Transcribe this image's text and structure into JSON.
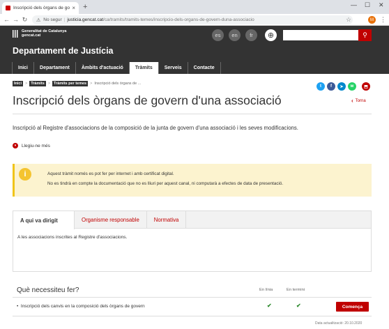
{
  "browser": {
    "tab_title": "Inscripció dels òrgans de govern",
    "tab_close": "×",
    "new_tab": "+",
    "minimize": "—",
    "maximize": "☐",
    "close": "✕",
    "security": "No segur",
    "url_domain": "justicia.gencat.cat",
    "url_path": "/ca/tramits/tramits-temes/inscripcio-dels-organs-de-govern-duna-associacio",
    "profile_initial": "M"
  },
  "header": {
    "logo_line1": "Generalitat de Catalunya",
    "logo_line2": "gencat.cat",
    "languages": [
      "es",
      "en",
      "fr"
    ],
    "search_placeholder": "",
    "department": "Departament de Justícia",
    "nav": [
      "Inici",
      "Departament",
      "Àmbits d'actuació",
      "Tràmits",
      "Serveis",
      "Contacte"
    ],
    "active_nav": "Tràmits"
  },
  "breadcrumb": {
    "items": [
      "Inici",
      "Tràmits",
      "Tràmits per temes"
    ],
    "current": "Inscripció dels òrgans de ..."
  },
  "share": {
    "twitter": "t",
    "facebook": "f",
    "telegram": "➤",
    "whatsapp": "w",
    "more": "⬒"
  },
  "page": {
    "title": "Inscripció dels òrgans de govern d'una associació",
    "back_label": "Torna",
    "intro": "Inscripció al Registre d'associacions de la composició de la junta de govern d'una associació i les seves modificacions.",
    "read_more": "Llegiu-ne més"
  },
  "notice": {
    "line1": "Aquest tràmit només es pot fer per internet i amb certificat digital.",
    "line2": "No es tindrà en compte la documentació que no es lliuri per aquest canal, ni computarà a efectes de data de presentació."
  },
  "content_tabs": {
    "tabs": [
      "A qui va dirigit",
      "Organisme responsable",
      "Normativa"
    ],
    "active": "A qui va dirigit",
    "body": "A les associacions inscrites al Registre d'associacions."
  },
  "needs": {
    "title": "Què necessiteu fer?",
    "col_online": "En línia",
    "col_deadline": "En termini",
    "rows": [
      {
        "label": "Inscripció dels canvis en la composició dels òrgans de govern",
        "online": true,
        "deadline": true,
        "action": "Comença"
      }
    ],
    "updated": "Data actualització: 20.10.2020"
  }
}
